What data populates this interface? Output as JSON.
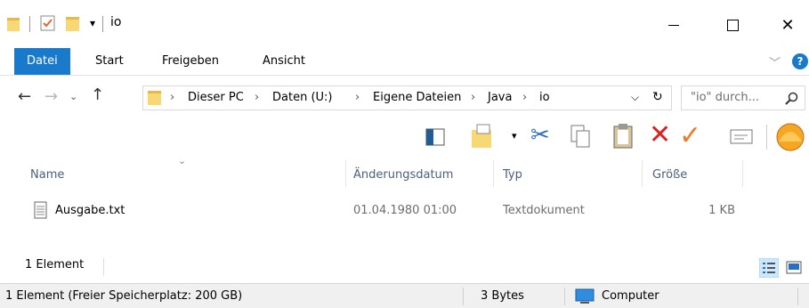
{
  "title": "io",
  "ribbon": {
    "tabs": [
      {
        "label": "Datei"
      },
      {
        "label": "Start"
      },
      {
        "label": "Freigeben"
      },
      {
        "label": "Ansicht"
      }
    ],
    "accent": "#1979ca"
  },
  "address": {
    "crumbs": [
      "Dieser PC",
      "Daten (U:)",
      "Eigene Dateien",
      "Java",
      "io"
    ],
    "search_placeholder": "\"io\" durch..."
  },
  "columns": {
    "name": "Name",
    "date": "Änderungsdatum",
    "type": "Typ",
    "size": "Größe"
  },
  "files": [
    {
      "name": "Ausgabe.txt",
      "date": "01.04.1980 01:00",
      "type": "Textdokument",
      "size": "1 KB",
      "icon": "text-file-icon"
    }
  ],
  "footer": {
    "count": "1 Element"
  },
  "status": {
    "left": "1 Element (Freier Speicherplatz: 200 GB)",
    "bytes": "3 Bytes",
    "location": "Computer"
  }
}
